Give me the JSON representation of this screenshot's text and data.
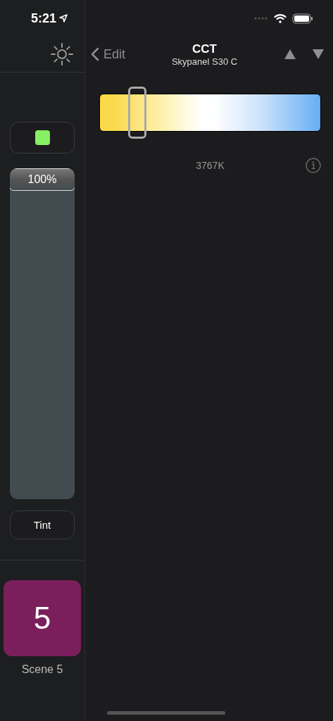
{
  "status_bar": {
    "time": "5:21"
  },
  "sidebar": {
    "swatch": {
      "color": "#86ef64"
    },
    "fader": {
      "level": 1,
      "reading": "100%"
    },
    "tint_button": "Tint",
    "scene": {
      "number": "5",
      "label": "Scene 5",
      "color": "#7a1f5c"
    }
  },
  "nav": {
    "back": "Edit",
    "title": "CCT",
    "subtitle": "Skypanel S30 C"
  },
  "cct": {
    "level": 0.17,
    "reading": "3767K"
  }
}
